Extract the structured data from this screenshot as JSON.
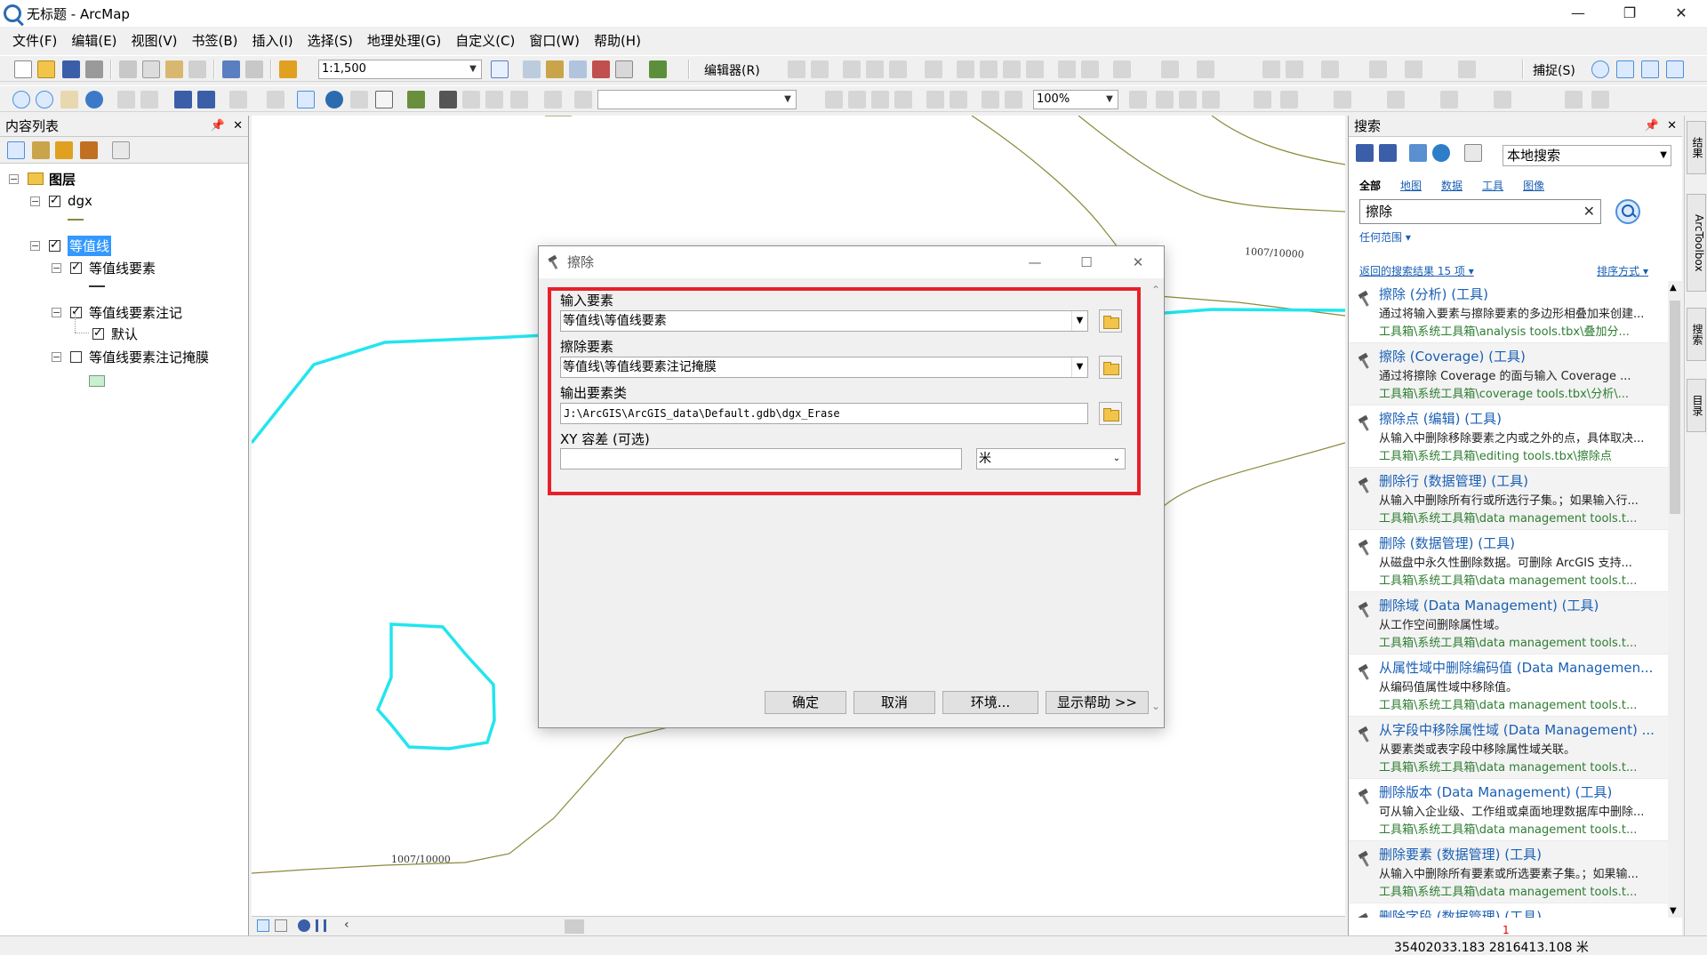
{
  "window": {
    "title": "无标题 - ArcMap",
    "minimize": "—",
    "maximize": "❐",
    "close": "✕"
  },
  "menu": [
    "文件(F)",
    "编辑(E)",
    "视图(V)",
    "书签(B)",
    "插入(I)",
    "选择(S)",
    "地理处理(G)",
    "自定义(C)",
    "窗口(W)",
    "帮助(H)"
  ],
  "toolbar": {
    "scale": "1:1,500",
    "editor_label": "编辑器(R)",
    "snap_label": "捕捉(S)",
    "zoom_percent": "100%"
  },
  "toc": {
    "title": "内容列表",
    "pin": "📌",
    "close": "✕",
    "root": "图层",
    "layers": [
      {
        "label": "dgx",
        "checked": true
      },
      {
        "label": "等值线",
        "checked": true
      },
      {
        "label": "等值线要素",
        "checked": true
      },
      {
        "label": "等值线要素注记",
        "checked": true
      },
      {
        "label": "默认",
        "checked": true
      },
      {
        "label": "等值线要素注记掩膜",
        "checked": false
      }
    ]
  },
  "map": {
    "label1": "1007/10000",
    "label2": "1007/10000"
  },
  "dialog": {
    "title": "擦除",
    "input_label": "输入要素",
    "input_value": "等值线\\等值线要素",
    "erase_label": "擦除要素",
    "erase_value": "等值线\\等值线要素注记掩膜",
    "output_label": "输出要素类",
    "output_value": "J:\\ArcGIS\\ArcGIS_data\\Default.gdb\\dgx_Erase",
    "xy_label": "XY 容差 (可选)",
    "xy_value": "",
    "xy_unit": "米",
    "btn_ok": "确定",
    "btn_cancel": "取消",
    "btn_env": "环境...",
    "btn_help": "显示帮助 >>"
  },
  "search": {
    "title": "搜索",
    "scope": "本地搜索",
    "tabs": [
      "全部",
      "地图",
      "数据",
      "工具",
      "图像"
    ],
    "query": "擦除",
    "clear": "✕",
    "extent": "任何范围 ▾",
    "result_count": "返回的搜索结果 15 项 ▾",
    "sort": "排序方式 ▾",
    "results": [
      {
        "title": "擦除 (分析) (工具)",
        "desc": "通过将输入要素与擦除要素的多边形相叠加来创建...",
        "path": "工具箱\\系统工具箱\\analysis tools.tbx\\叠加分..."
      },
      {
        "title": "擦除 (Coverage) (工具)",
        "desc": "通过将擦除 Coverage 的面与输入 Coverage ...",
        "path": "工具箱\\系统工具箱\\coverage tools.tbx\\分析\\..."
      },
      {
        "title": "擦除点 (编辑) (工具)",
        "desc": "从输入中删除移除要素之内或之外的点，具体取决...",
        "path": "工具箱\\系统工具箱\\editing tools.tbx\\擦除点"
      },
      {
        "title": "删除行 (数据管理) (工具)",
        "desc": "从输入中删除所有行或所选行子集。；如果输入行...",
        "path": "工具箱\\系统工具箱\\data management tools.t..."
      },
      {
        "title": "删除 (数据管理) (工具)",
        "desc": "从磁盘中永久性删除数据。可删除 ArcGIS 支持...",
        "path": "工具箱\\系统工具箱\\data management tools.t..."
      },
      {
        "title": "删除域 (Data Management) (工具)",
        "desc": "从工作空间删除属性域。",
        "path": "工具箱\\系统工具箱\\data management tools.t..."
      },
      {
        "title": "从属性域中删除编码值 (Data Managemen...",
        "desc": "从编码值属性域中移除值。",
        "path": "工具箱\\系统工具箱\\data management tools.t..."
      },
      {
        "title": "从字段中移除属性域 (Data Management) ...",
        "desc": "从要素类或表字段中移除属性域关联。",
        "path": "工具箱\\系统工具箱\\data management tools.t..."
      },
      {
        "title": "删除版本 (Data Management) (工具)",
        "desc": "可从输入企业级、工作组或桌面地理数据库中删除...",
        "path": "工具箱\\系统工具箱\\data management tools.t..."
      },
      {
        "title": "删除要素 (数据管理) (工具)",
        "desc": "从输入中删除所有要素或所选要素子集。；如果输...",
        "path": "工具箱\\系统工具箱\\data management tools.t..."
      },
      {
        "title": "删除字段 (数据管理) (工具)",
        "desc": "",
        "path": ""
      }
    ]
  },
  "dock_tabs": [
    "结果",
    "ArcToolbox",
    "搜索",
    "目录"
  ],
  "status": {
    "coords": "35402033.183  2816413.108 米",
    "marker": "1"
  },
  "colors": {
    "cyan_line": "#22e5ee",
    "contour": "#8a8a3a",
    "highlight_box": "#e8202a",
    "selection": "#3399ff"
  }
}
